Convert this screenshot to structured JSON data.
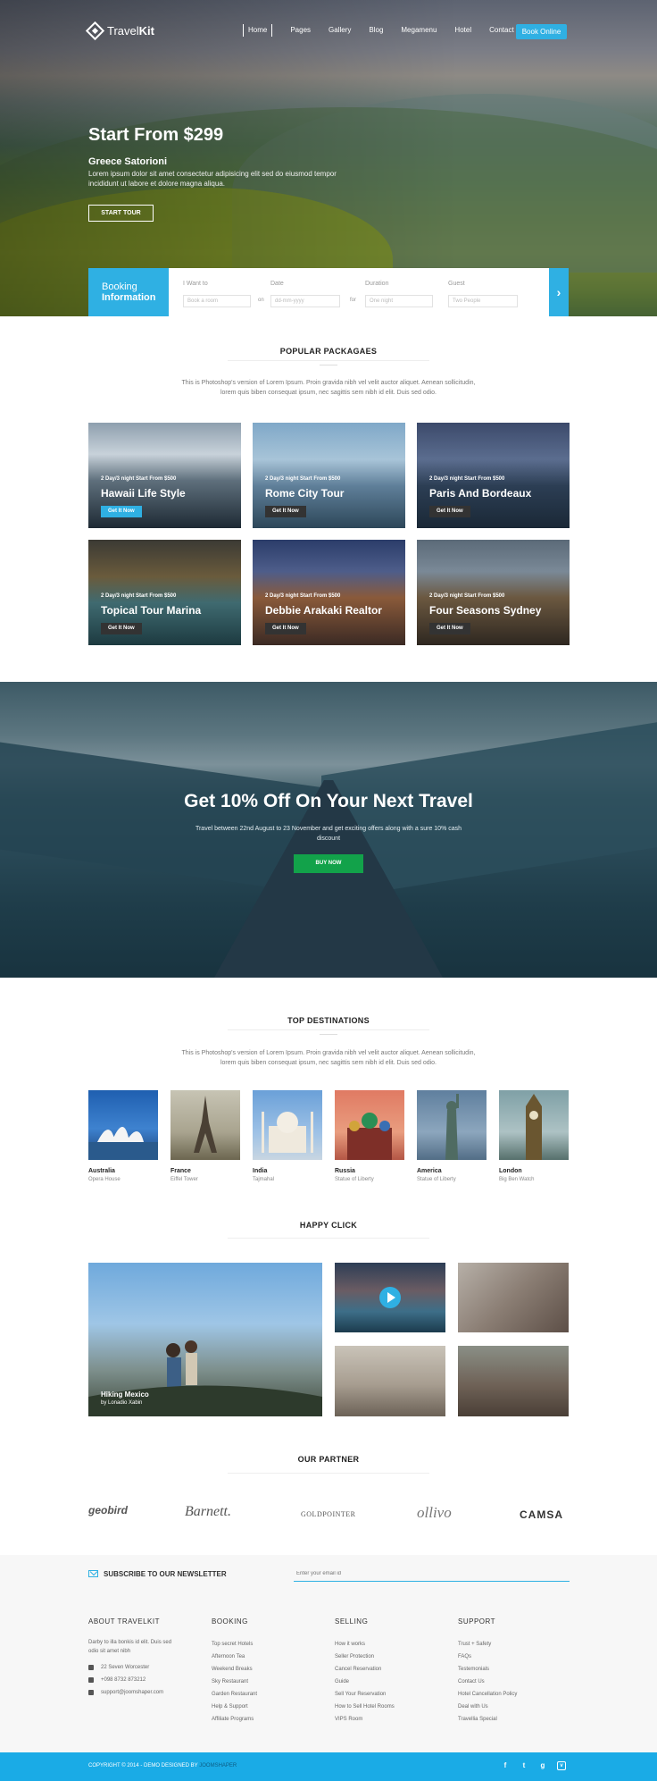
{
  "header": {
    "logo_text_a": "Travel",
    "logo_text_b": "Kit",
    "nav": [
      "Home",
      "Pages",
      "Gallery",
      "Blog",
      "Megamenu",
      "Hotel",
      "Contact"
    ],
    "book_button": "Book Online"
  },
  "hero": {
    "title": "Start From $299",
    "subtitle": "Greece Satorioni",
    "text": "Lorem ipsum dolor sit amet consectetur adipisicing elit sed do eiusmod tempor incididunt ut labore et dolore magna aliqua.",
    "button": "START TOUR"
  },
  "booking": {
    "label_1": "Booking",
    "label_2": "Information",
    "want_label": "I Want to",
    "want_placeholder": "Book a room",
    "on": "on",
    "date_label": "Date",
    "date_placeholder": "dd-mm-yyyy",
    "for": "for",
    "duration_label": "Duration",
    "duration_placeholder": "One night",
    "guest_label": "Guest",
    "guest_placeholder": "Two People"
  },
  "packages": {
    "title": "POPULAR PACKAGAES",
    "desc": "This is Photoshop's version of Lorem Ipsum. Proin gravida nibh vel velit auctor aliquet. Aenean sollicitudin, lorem quis biben consequat ipsum, nec sagittis sem nibh id elit. Duis sed odio.",
    "items": [
      {
        "small": "2 Day/3 night Start From $500",
        "name": "Hawaii Life Style",
        "btn": "Get It Now"
      },
      {
        "small": "2 Day/3 night Start From $500",
        "name": "Rome City Tour",
        "btn": "Get It Now"
      },
      {
        "small": "2 Day/3 night Start From $500",
        "name": "Paris And Bordeaux",
        "btn": "Get It Now"
      },
      {
        "small": "2 Day/3 night Start From $500",
        "name": "Topical Tour Marina",
        "btn": "Get It Now"
      },
      {
        "small": "2 Day/3 night Start From $500",
        "name": "Debbie Arakaki Realtor",
        "btn": "Get It Now"
      },
      {
        "small": "2 Day/3 night Start From $500",
        "name": "Four Seasons Sydney",
        "btn": "Get It Now"
      }
    ]
  },
  "promo": {
    "title": "Get 10% Off On Your Next Travel",
    "text": "Travel between 22nd August to 23 November and get exciting offers along with a sure 10% cash discount",
    "button": "BUY NOW"
  },
  "destinations": {
    "title": "TOP DESTINATIONS",
    "desc": "This is Photoshop's version of Lorem Ipsum. Proin gravida nibh vel velit auctor aliquet. Aenean sollicitudin, lorem quis biben consequat ipsum, nec sagittis sem nibh id elit. Duis sed odio.",
    "items": [
      {
        "name": "Australia",
        "place": "Opera House"
      },
      {
        "name": "France",
        "place": "Eiffel Tower"
      },
      {
        "name": "India",
        "place": "Tajmahal"
      },
      {
        "name": "Russia",
        "place": "Statue of Liberty"
      },
      {
        "name": "America",
        "place": "Statue of Liberty"
      },
      {
        "name": "London",
        "place": "Big Ben Watch"
      }
    ]
  },
  "happy": {
    "title": "HAPPY CLICK",
    "caption_title": "Hiking Mexico",
    "caption_by": "by Lonadio Xabin"
  },
  "partners": {
    "title": "OUR PARTNER",
    "items": [
      "geobird",
      "Barnett.",
      "GOLDPOINTER",
      "ollivo",
      "CAMSA"
    ]
  },
  "newsletter": {
    "label": "SUBSCRIBE  TO OUR NEWSLETTER",
    "placeholder": "Enter your email id"
  },
  "footer": {
    "about": {
      "title": "ABOUT TRAVELKIT",
      "text": "Darby to illa bonkis id elit. Duis sed odio sit amet nibh",
      "address": "22 Seven Worcester",
      "phone": "+098 8732 873212",
      "email": "support@joomshaper.com"
    },
    "booking": {
      "title": "BOOKING",
      "links": [
        "Top secret Hotels",
        "Afternoon Tea",
        "Weekend Breaks",
        "Sky Restaurant",
        "Garden Restaurant",
        "Help & Support",
        "Affiliate Programs"
      ]
    },
    "selling": {
      "title": "SELLING",
      "links": [
        "How it works",
        "Seller Protection",
        "Cancel Reservation",
        "Guide",
        "Sell Your Reservation",
        "How to Sell Hotel Rooms",
        "VIPS Room"
      ]
    },
    "support": {
      "title": "SUPPORT",
      "links": [
        "Trust + Safety",
        "FAQs",
        "Testemonials",
        "Contact Us",
        "Hotel Cancellation Policy",
        "Deal with Us",
        "Travellia Special"
      ]
    }
  },
  "bottom": {
    "copyright": "COPYRIGHT © 2014 - DEMO DESIGNED BY ",
    "brand": "JOOMSHAPER",
    "social": [
      "f",
      "t",
      "g",
      "v"
    ]
  },
  "colors": {
    "accent": "#2fb0e3",
    "buy": "#12a24a",
    "footer_bar": "#1aabe6"
  }
}
